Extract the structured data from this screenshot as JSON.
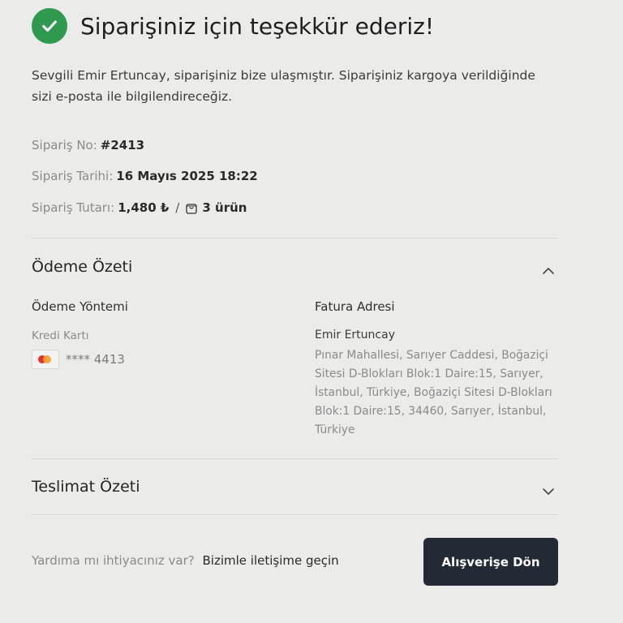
{
  "header": {
    "title": "Siparişiniz için teşekkür ederiz!"
  },
  "intro": "Sevgili Emir Ertuncay, siparişiniz bize ulaşmıştır. Siparişiniz kargoya verildiğinde sizi e-posta ile bilgilendireceğiz.",
  "order": {
    "no_label": "Sipariş No:",
    "no_value": "#2413",
    "date_label": "Sipariş Tarihi:",
    "date_value": "16 Mayıs 2025 18:22",
    "total_label": "Sipariş Tutarı:",
    "total_value": "1,480 ₺",
    "separator": "/",
    "items_count": "3 ürün"
  },
  "payment_summary": {
    "title": "Ödeme Özeti",
    "expanded": true,
    "method_heading": "Ödeme Yöntemi",
    "method_type": "Kredi Kartı",
    "card_number": "**** 4413",
    "card_brand": "mastercard",
    "billing_heading": "Fatura Adresi",
    "billing_name": "Emir Ertuncay",
    "billing_address": "Pınar Mahallesi, Sarıyer Caddesi, Boğaziçi Sitesi D-Blokları Blok:1 Daire:15, Sarıyer, İstanbul, Türkiye, Boğaziçi Sitesi D-Blokları Blok:1 Daire:15, 34460, Sarıyer, İstanbul, Türkiye"
  },
  "delivery_summary": {
    "title": "Teslimat Özeti",
    "expanded": false
  },
  "footer": {
    "help_question": "Yardıma mı ihtiyacınız var?",
    "help_link": "Bizimle iletişime geçin",
    "cta_label": "Alışverişe Dön"
  },
  "colors": {
    "success": "#2e9a4f",
    "button_bg": "#242a35",
    "background": "#ebebe9"
  },
  "icons": [
    "check-icon",
    "shopping-bag-icon",
    "chevron-up-icon",
    "chevron-down-icon",
    "mastercard-icon"
  ]
}
